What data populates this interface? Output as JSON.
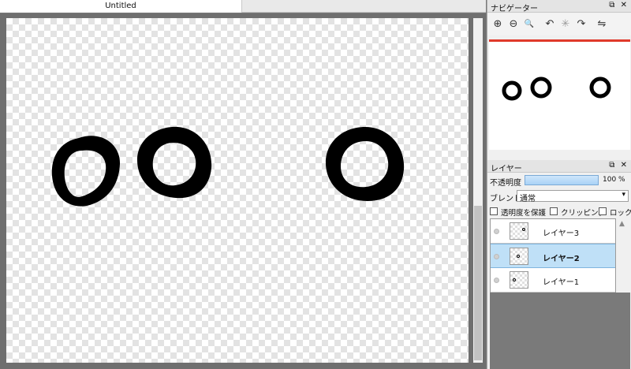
{
  "document": {
    "tab_title": "Untitled"
  },
  "navigator": {
    "title": "ナビゲーター",
    "tools": [
      {
        "name": "zoom-in-icon",
        "glyph": "⊕"
      },
      {
        "name": "zoom-out-icon",
        "glyph": "⊖"
      },
      {
        "name": "zoom-fit-icon",
        "glyph": "🔍"
      },
      {
        "name": "rotate-left-icon",
        "glyph": "↶"
      },
      {
        "name": "rotate-reset-icon",
        "glyph": "✳"
      },
      {
        "name": "rotate-right-icon",
        "glyph": "↷"
      },
      {
        "name": "flip-horizontal-icon",
        "glyph": "⇋"
      }
    ],
    "accent_color": "#e03a2b"
  },
  "layers_panel": {
    "title": "レイヤー",
    "opacity_label": "不透明度",
    "opacity_value": "100 %",
    "opacity_fraction": 1.0,
    "blend_label": "ブレンド",
    "blend_value": "通常",
    "checkboxes": [
      {
        "label": "透明度を保護",
        "checked": false
      },
      {
        "label": "クリッピング",
        "checked": false
      },
      {
        "label": "ロック",
        "checked": false
      }
    ],
    "layers": [
      {
        "name": "レイヤー3",
        "selected": false
      },
      {
        "name": "レイヤー2",
        "selected": true
      },
      {
        "name": "レイヤー1",
        "selected": false
      }
    ],
    "selection_color": "#bfe0f7"
  },
  "panel_buttons": {
    "float": "⧉",
    "close": "✕"
  }
}
